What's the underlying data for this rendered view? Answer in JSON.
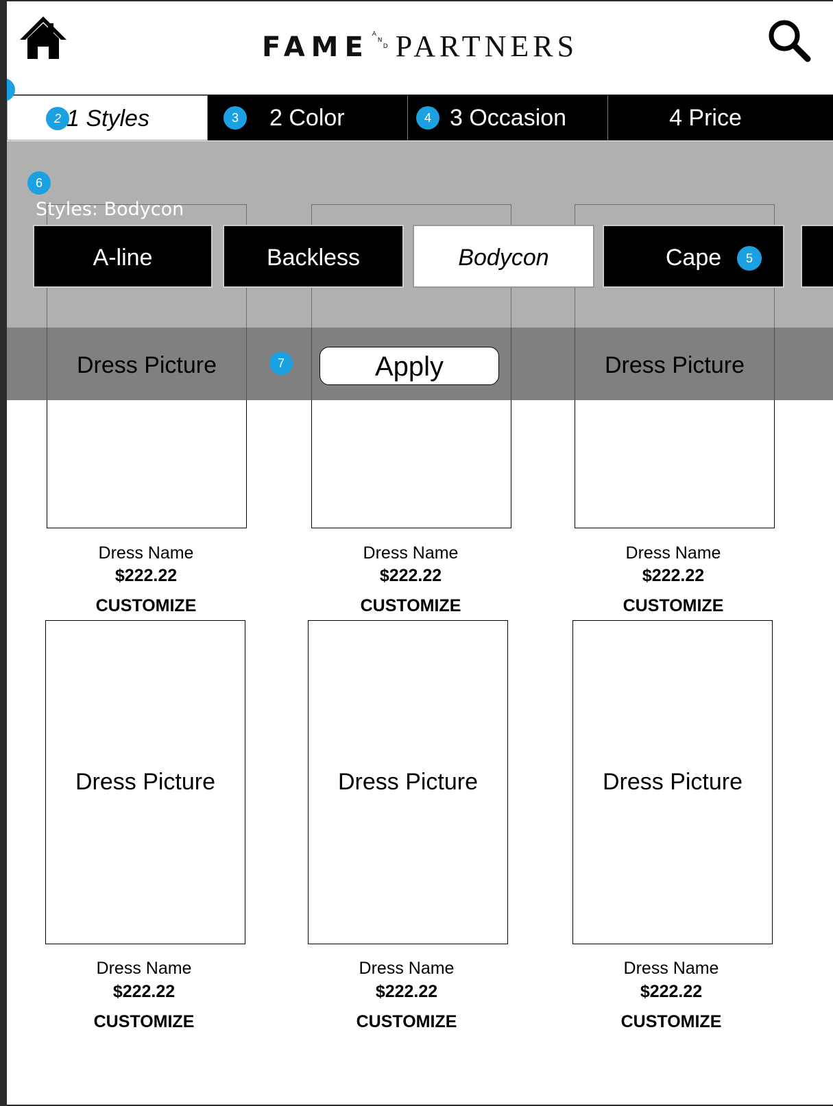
{
  "header": {
    "brand_left": "FAME",
    "brand_and": [
      "A",
      "N",
      "D"
    ],
    "brand_right": "PARTNERS"
  },
  "tabs": [
    {
      "label": "1 Styles",
      "badge": "2",
      "active": true
    },
    {
      "label": "2 Color",
      "badge": "3",
      "active": false
    },
    {
      "label": "3 Occasion",
      "badge": "4",
      "active": false
    },
    {
      "label": "4 Price",
      "badge": "",
      "active": false
    }
  ],
  "filter": {
    "badge": "6",
    "title": "Styles: Bodycon",
    "options": [
      {
        "label": "A-line",
        "selected": false
      },
      {
        "label": "Backless",
        "selected": false
      },
      {
        "label": "Bodycon",
        "selected": true
      },
      {
        "label": "Cape",
        "selected": false,
        "badge": "5"
      }
    ],
    "apply_label": "Apply",
    "apply_badge": "7"
  },
  "products": [
    {
      "picture_label": "Dress Picture",
      "name": "Dress Name",
      "price": "$222.22",
      "action": "CUSTOMIZE"
    },
    {
      "picture_label": "Dress Picture",
      "name": "Dress Name",
      "price": "$222.22",
      "action": "CUSTOMIZE"
    },
    {
      "picture_label": "Dress Picture",
      "name": "Dress Name",
      "price": "$222.22",
      "action": "CUSTOMIZE"
    },
    {
      "picture_label": "Dress Picture",
      "name": "Dress Name",
      "price": "$222.22",
      "action": "CUSTOMIZE"
    },
    {
      "picture_label": "Dress Picture",
      "name": "Dress Name",
      "price": "$222.22",
      "action": "CUSTOMIZE"
    },
    {
      "picture_label": "Dress Picture",
      "name": "Dress Name",
      "price": "$222.22",
      "action": "CUSTOMIZE"
    }
  ],
  "colors": {
    "accent_badge": "#1ba1e2",
    "tab_bg": "#000000"
  },
  "icons": {
    "home": "home-icon",
    "search": "search-icon"
  }
}
